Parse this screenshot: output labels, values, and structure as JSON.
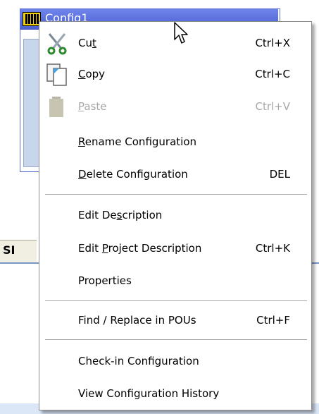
{
  "window": {
    "title": "Config1"
  },
  "background_panel": {
    "tab_text": "SI"
  },
  "menu": {
    "items": [
      {
        "id": "cut",
        "label": "Cut",
        "mnemonic_index": 2,
        "shortcut": "Ctrl+X",
        "icon": "scissors-icon",
        "enabled": true
      },
      {
        "id": "copy",
        "label": "Copy",
        "mnemonic_index": 0,
        "shortcut": "Ctrl+C",
        "icon": "copy-icon",
        "enabled": true
      },
      {
        "id": "paste",
        "label": "Paste",
        "mnemonic_index": 0,
        "shortcut": "Ctrl+V",
        "icon": "paste-icon",
        "enabled": false
      },
      {
        "id": "rename",
        "label": "Rename Configuration",
        "mnemonic_index": 0,
        "shortcut": "",
        "enabled": true
      },
      {
        "id": "delete",
        "label": "Delete Configuration",
        "mnemonic_index": 0,
        "shortcut": "DEL",
        "enabled": true
      },
      {
        "id": "edit-desc",
        "label": "Edit Description",
        "mnemonic_index": 7,
        "shortcut": "",
        "enabled": true
      },
      {
        "id": "edit-proj-desc",
        "label": "Edit Project Description",
        "mnemonic_index": 5,
        "shortcut": "Ctrl+K",
        "enabled": true
      },
      {
        "id": "properties",
        "label": "Properties",
        "mnemonic_index": -1,
        "shortcut": "",
        "enabled": true
      },
      {
        "id": "find-replace",
        "label": "Find / Replace in POUs",
        "mnemonic_index": -1,
        "shortcut": "Ctrl+F",
        "enabled": true
      },
      {
        "id": "checkin",
        "label": "Check-in Configuration",
        "mnemonic_index": -1,
        "shortcut": "",
        "enabled": true
      },
      {
        "id": "history",
        "label": "View Configuration History",
        "mnemonic_index": -1,
        "shortcut": "",
        "enabled": true
      }
    ]
  },
  "colors": {
    "titlebar": "#5a6fe0",
    "disabled_text": "#a7a7a7",
    "separator": "#a6a6a6"
  }
}
